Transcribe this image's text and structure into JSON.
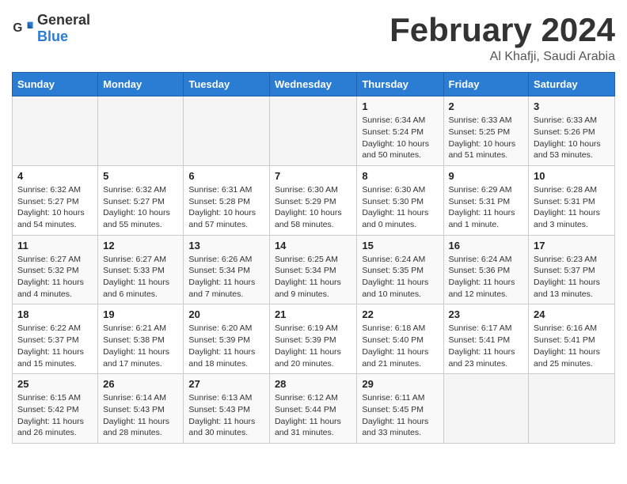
{
  "header": {
    "logo_general": "General",
    "logo_blue": "Blue",
    "title": "February 2024",
    "location": "Al Khafji, Saudi Arabia"
  },
  "weekdays": [
    "Sunday",
    "Monday",
    "Tuesday",
    "Wednesday",
    "Thursday",
    "Friday",
    "Saturday"
  ],
  "weeks": [
    [
      {
        "day": "",
        "detail": ""
      },
      {
        "day": "",
        "detail": ""
      },
      {
        "day": "",
        "detail": ""
      },
      {
        "day": "",
        "detail": ""
      },
      {
        "day": "1",
        "detail": "Sunrise: 6:34 AM\nSunset: 5:24 PM\nDaylight: 10 hours\nand 50 minutes."
      },
      {
        "day": "2",
        "detail": "Sunrise: 6:33 AM\nSunset: 5:25 PM\nDaylight: 10 hours\nand 51 minutes."
      },
      {
        "day": "3",
        "detail": "Sunrise: 6:33 AM\nSunset: 5:26 PM\nDaylight: 10 hours\nand 53 minutes."
      }
    ],
    [
      {
        "day": "4",
        "detail": "Sunrise: 6:32 AM\nSunset: 5:27 PM\nDaylight: 10 hours\nand 54 minutes."
      },
      {
        "day": "5",
        "detail": "Sunrise: 6:32 AM\nSunset: 5:27 PM\nDaylight: 10 hours\nand 55 minutes."
      },
      {
        "day": "6",
        "detail": "Sunrise: 6:31 AM\nSunset: 5:28 PM\nDaylight: 10 hours\nand 57 minutes."
      },
      {
        "day": "7",
        "detail": "Sunrise: 6:30 AM\nSunset: 5:29 PM\nDaylight: 10 hours\nand 58 minutes."
      },
      {
        "day": "8",
        "detail": "Sunrise: 6:30 AM\nSunset: 5:30 PM\nDaylight: 11 hours\nand 0 minutes."
      },
      {
        "day": "9",
        "detail": "Sunrise: 6:29 AM\nSunset: 5:31 PM\nDaylight: 11 hours\nand 1 minute."
      },
      {
        "day": "10",
        "detail": "Sunrise: 6:28 AM\nSunset: 5:31 PM\nDaylight: 11 hours\nand 3 minutes."
      }
    ],
    [
      {
        "day": "11",
        "detail": "Sunrise: 6:27 AM\nSunset: 5:32 PM\nDaylight: 11 hours\nand 4 minutes."
      },
      {
        "day": "12",
        "detail": "Sunrise: 6:27 AM\nSunset: 5:33 PM\nDaylight: 11 hours\nand 6 minutes."
      },
      {
        "day": "13",
        "detail": "Sunrise: 6:26 AM\nSunset: 5:34 PM\nDaylight: 11 hours\nand 7 minutes."
      },
      {
        "day": "14",
        "detail": "Sunrise: 6:25 AM\nSunset: 5:34 PM\nDaylight: 11 hours\nand 9 minutes."
      },
      {
        "day": "15",
        "detail": "Sunrise: 6:24 AM\nSunset: 5:35 PM\nDaylight: 11 hours\nand 10 minutes."
      },
      {
        "day": "16",
        "detail": "Sunrise: 6:24 AM\nSunset: 5:36 PM\nDaylight: 11 hours\nand 12 minutes."
      },
      {
        "day": "17",
        "detail": "Sunrise: 6:23 AM\nSunset: 5:37 PM\nDaylight: 11 hours\nand 13 minutes."
      }
    ],
    [
      {
        "day": "18",
        "detail": "Sunrise: 6:22 AM\nSunset: 5:37 PM\nDaylight: 11 hours\nand 15 minutes."
      },
      {
        "day": "19",
        "detail": "Sunrise: 6:21 AM\nSunset: 5:38 PM\nDaylight: 11 hours\nand 17 minutes."
      },
      {
        "day": "20",
        "detail": "Sunrise: 6:20 AM\nSunset: 5:39 PM\nDaylight: 11 hours\nand 18 minutes."
      },
      {
        "day": "21",
        "detail": "Sunrise: 6:19 AM\nSunset: 5:39 PM\nDaylight: 11 hours\nand 20 minutes."
      },
      {
        "day": "22",
        "detail": "Sunrise: 6:18 AM\nSunset: 5:40 PM\nDaylight: 11 hours\nand 21 minutes."
      },
      {
        "day": "23",
        "detail": "Sunrise: 6:17 AM\nSunset: 5:41 PM\nDaylight: 11 hours\nand 23 minutes."
      },
      {
        "day": "24",
        "detail": "Sunrise: 6:16 AM\nSunset: 5:41 PM\nDaylight: 11 hours\nand 25 minutes."
      }
    ],
    [
      {
        "day": "25",
        "detail": "Sunrise: 6:15 AM\nSunset: 5:42 PM\nDaylight: 11 hours\nand 26 minutes."
      },
      {
        "day": "26",
        "detail": "Sunrise: 6:14 AM\nSunset: 5:43 PM\nDaylight: 11 hours\nand 28 minutes."
      },
      {
        "day": "27",
        "detail": "Sunrise: 6:13 AM\nSunset: 5:43 PM\nDaylight: 11 hours\nand 30 minutes."
      },
      {
        "day": "28",
        "detail": "Sunrise: 6:12 AM\nSunset: 5:44 PM\nDaylight: 11 hours\nand 31 minutes."
      },
      {
        "day": "29",
        "detail": "Sunrise: 6:11 AM\nSunset: 5:45 PM\nDaylight: 11 hours\nand 33 minutes."
      },
      {
        "day": "",
        "detail": ""
      },
      {
        "day": "",
        "detail": ""
      }
    ]
  ]
}
